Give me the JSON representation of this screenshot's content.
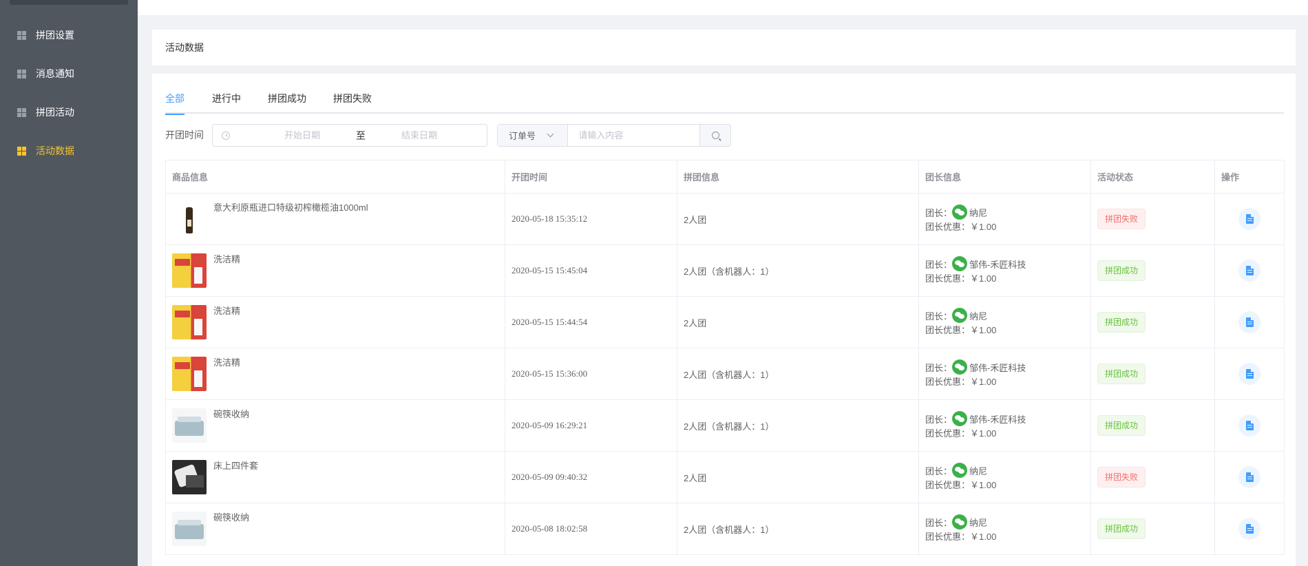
{
  "sidebar": {
    "items": [
      {
        "label": "拼团设置",
        "icon": "grid-icon"
      },
      {
        "label": "消息通知",
        "icon": "grid-icon"
      },
      {
        "label": "拼团活动",
        "icon": "grid-icon"
      },
      {
        "label": "活动数据",
        "icon": "grid-icon",
        "active": true
      }
    ],
    "active_color": "#f4c430"
  },
  "page": {
    "title": "活动数据"
  },
  "tabs": [
    {
      "label": "全部",
      "active": true
    },
    {
      "label": "进行中"
    },
    {
      "label": "拼团成功"
    },
    {
      "label": "拼团失败"
    }
  ],
  "filter": {
    "label": "开团时间",
    "start_placeholder": "开始日期",
    "separator": "至",
    "end_placeholder": "结束日期",
    "select_value": "订单号",
    "search_placeholder": "请输入内容"
  },
  "table": {
    "headers": [
      "商品信息",
      "开团时间",
      "拼团信息",
      "团长信息",
      "活动状态",
      "操作"
    ],
    "leader_prefix": "团长：",
    "discount_prefix": "团长优惠：",
    "rows": [
      {
        "product": "意大利原瓶进口特级初榨橄榄油1000ml",
        "thumb": "oil",
        "time": "2020-05-18 15:35:12",
        "group": "2人团",
        "leader": "纳尼",
        "discount": "￥1.00",
        "status": "拼团失败",
        "status_type": "fail"
      },
      {
        "product": "洗洁精",
        "thumb": "det",
        "time": "2020-05-15 15:45:04",
        "group": "2人团（含机器人：1）",
        "leader": "邹伟-禾匠科技",
        "discount": "￥1.00",
        "status": "拼团成功",
        "status_type": "success"
      },
      {
        "product": "洗洁精",
        "thumb": "det",
        "time": "2020-05-15 15:44:54",
        "group": "2人团",
        "leader": "纳尼",
        "discount": "￥1.00",
        "status": "拼团成功",
        "status_type": "success"
      },
      {
        "product": "洗洁精",
        "thumb": "det",
        "time": "2020-05-15 15:36:00",
        "group": "2人团（含机器人：1）",
        "leader": "邹伟-禾匠科技",
        "discount": "￥1.00",
        "status": "拼团成功",
        "status_type": "success"
      },
      {
        "product": "碗筷收纳",
        "thumb": "box",
        "time": "2020-05-09 16:29:21",
        "group": "2人团（含机器人：1）",
        "leader": "邹伟-禾匠科技",
        "discount": "￥1.00",
        "status": "拼团成功",
        "status_type": "success"
      },
      {
        "product": "床上四件套",
        "thumb": "bed",
        "time": "2020-05-09 09:40:32",
        "group": "2人团",
        "leader": "纳尼",
        "discount": "￥1.00",
        "status": "拼团失败",
        "status_type": "fail"
      },
      {
        "product": "碗筷收纳",
        "thumb": "box",
        "time": "2020-05-08 18:02:58",
        "group": "2人团（含机器人：1）",
        "leader": "纳尼",
        "discount": "￥1.00",
        "status": "拼团成功",
        "status_type": "success"
      }
    ]
  },
  "colors": {
    "sidebar_bg": "#50575f",
    "primary": "#409eff",
    "success": "#67c23a",
    "danger": "#f56c6c",
    "wechat": "#3cb04a"
  }
}
